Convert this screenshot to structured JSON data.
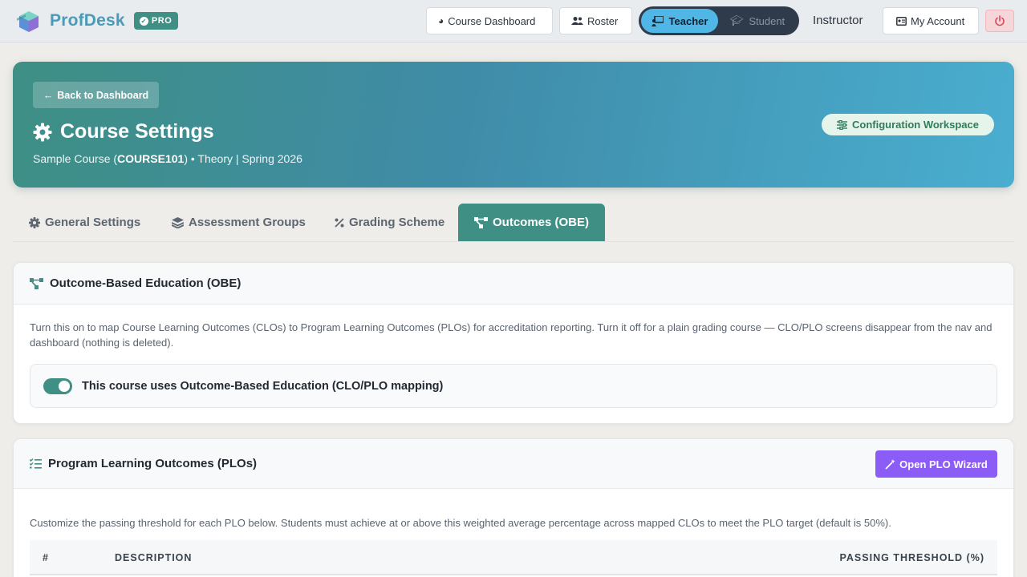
{
  "brand": {
    "name": "ProfDesk",
    "badge": "PRO"
  },
  "nav": {
    "course_dashboard": "Course Dashboard",
    "roster": "Roster",
    "role_teacher": "Teacher",
    "role_student": "Student",
    "user_role": "Instructor",
    "my_account": "My Account"
  },
  "hero": {
    "back_label": "Back to Dashboard",
    "title": "Course Settings",
    "course_name": "Sample Course (",
    "course_code": "COURSE101",
    "course_meta": ") • Theory | Spring 2026",
    "workspace_pill": "Configuration Workspace"
  },
  "tabs": [
    {
      "label": "General Settings",
      "icon": "gear-icon"
    },
    {
      "label": "Assessment Groups",
      "icon": "layers-icon"
    },
    {
      "label": "Grading Scheme",
      "icon": "percent-icon"
    },
    {
      "label": "Outcomes (OBE)",
      "icon": "diagram-icon",
      "active": true
    }
  ],
  "obe_card": {
    "title": "Outcome-Based Education (OBE)",
    "description": "Turn this on to map Course Learning Outcomes (CLOs) to Program Learning Outcomes (PLOs) for accreditation reporting. Turn it off for a plain grading course — CLO/PLO screens disappear from the nav and dashboard (nothing is deleted).",
    "toggle_label": "This course uses Outcome-Based Education (CLO/PLO mapping)",
    "toggle_on": true
  },
  "plo_card": {
    "title": "Program Learning Outcomes (PLOs)",
    "wizard_button": "Open PLO Wizard",
    "description": "Customize the passing threshold for each PLO below. Students must achieve at or above this weighted average percentage across mapped CLOs to meet the PLO target (default is 50%).",
    "columns": [
      "#",
      "DESCRIPTION",
      "PASSING THRESHOLD (%)"
    ]
  },
  "colors": {
    "accent": "#3f8f85",
    "brand": "#4a9bb8",
    "wizard": "#8b5cf6",
    "active_role": "#4fb6e6"
  }
}
